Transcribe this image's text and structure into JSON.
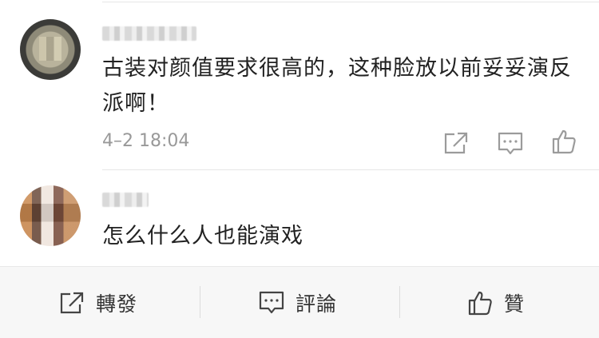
{
  "comments": [
    {
      "text": "古装对颜值要求很高的，这种脸放以前妥妥演反派啊！",
      "time": "4–2 18:04"
    },
    {
      "text": "怎么什么人也能演戏"
    }
  ],
  "actions_bar": {
    "repost_label": "轉發",
    "comment_label": "評論",
    "like_label": "贊"
  }
}
